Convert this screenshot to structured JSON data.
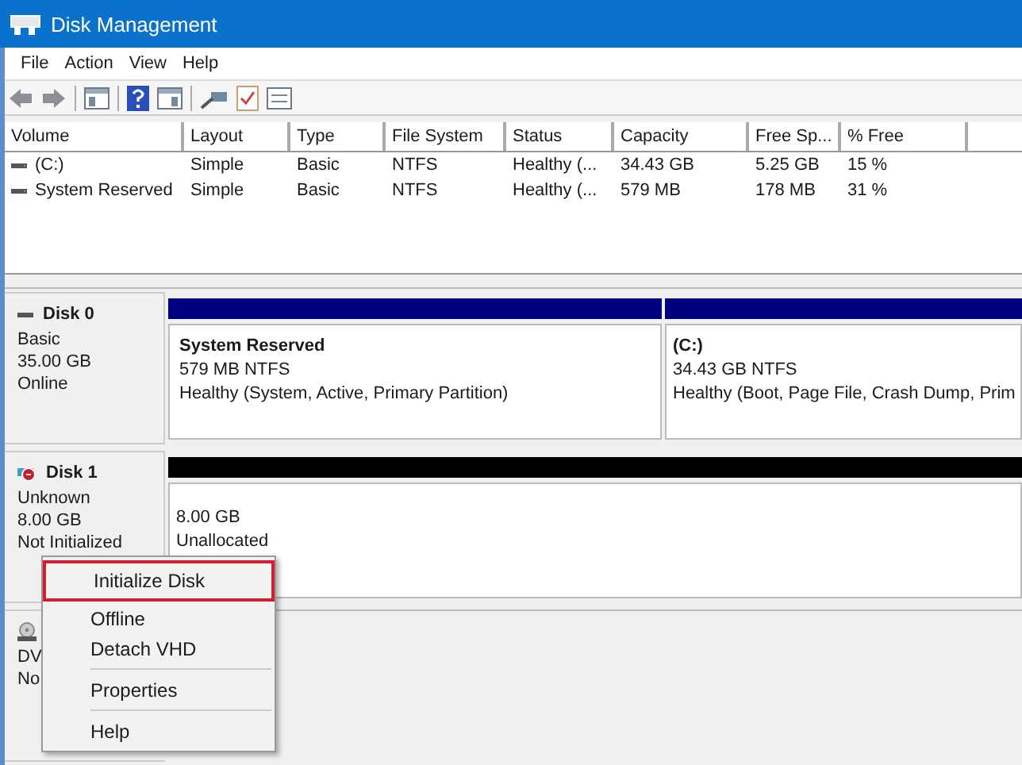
{
  "window": {
    "title": "Disk Management"
  },
  "menu_bar": [
    "File",
    "Action",
    "View",
    "Help"
  ],
  "volume_list": {
    "columns": [
      "Volume",
      "Layout",
      "Type",
      "File System",
      "Status",
      "Capacity",
      "Free Sp...",
      "% Free"
    ],
    "rows": [
      {
        "kind": "drive",
        "cells": [
          "(C:)",
          "Simple",
          "Basic",
          "NTFS",
          "Healthy (...",
          "34.43 GB",
          "5.25 GB",
          "15 %"
        ]
      },
      {
        "kind": "drive",
        "cells": [
          "System Reserved",
          "Simple",
          "Basic",
          "NTFS",
          "Healthy (...",
          "579 MB",
          "178 MB",
          "31 %"
        ]
      }
    ]
  },
  "disks": [
    {
      "kind": "basic",
      "name": "Disk 0",
      "lines": [
        "Basic",
        "35.00 GB",
        "Online"
      ],
      "partitions": [
        {
          "color": "#000080",
          "name": "System Reserved",
          "lines": [
            "579 MB NTFS",
            "Healthy (System, Active, Primary Partition)"
          ]
        },
        {
          "color": "#000080",
          "name": "(C:)",
          "lines": [
            "34.43 GB NTFS",
            "Healthy (Boot, Page File, Crash Dump, Prim"
          ]
        }
      ]
    },
    {
      "kind": "unknown",
      "name": "Disk 1",
      "lines": [
        "Unknown",
        "8.00 GB",
        "Not Initialized"
      ],
      "partitions": [
        {
          "color": "#000000",
          "lines": [
            "8.00 GB",
            "Unallocated"
          ]
        }
      ]
    },
    {
      "kind": "dvd",
      "lines": [
        "DV",
        "No"
      ]
    }
  ],
  "context_menu": [
    [
      {
        "label": "Initialize Disk",
        "selected": true
      },
      {
        "label": "Offline",
        "selected": false
      },
      {
        "label": "Detach VHD",
        "selected": false
      }
    ],
    [
      {
        "label": "Properties",
        "selected": false
      }
    ],
    [
      {
        "label": "Help",
        "selected": false
      }
    ]
  ]
}
